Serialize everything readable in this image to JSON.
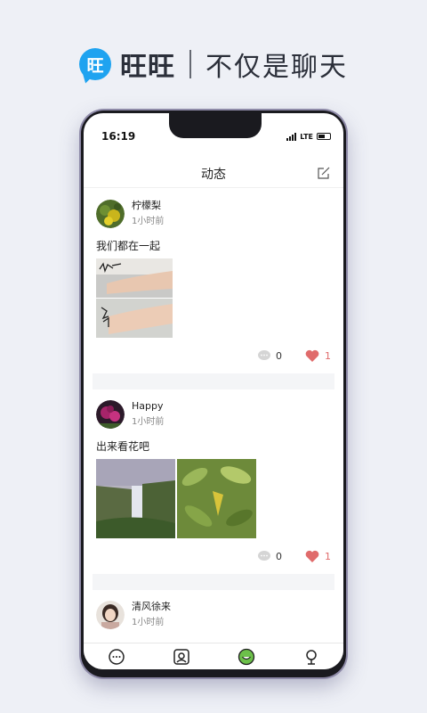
{
  "promo": {
    "logo_char": "旺",
    "app_name": "旺旺",
    "slogan": "不仅是聊天"
  },
  "status_bar": {
    "time": "16:19",
    "network": "LTE"
  },
  "header": {
    "title": "动态"
  },
  "posts": [
    {
      "author": "柠檬梨",
      "time": "1小时前",
      "text": "我们都在一起",
      "comments": "0",
      "likes": "1"
    },
    {
      "author": "Happy",
      "time": "1小时前",
      "text": "出来看花吧",
      "comments": "0",
      "likes": "1"
    },
    {
      "author": "清风徐来",
      "time": "1小时前"
    }
  ],
  "tabs": [
    {
      "icon": "chat-bubble-icon"
    },
    {
      "icon": "contacts-card-icon"
    },
    {
      "icon": "smiley-moments-icon",
      "active": true
    },
    {
      "icon": "profile-person-icon"
    }
  ],
  "colors": {
    "accent": "#1fa3f0",
    "like": "#e06b6b",
    "active_tab": "#6cc04a"
  }
}
